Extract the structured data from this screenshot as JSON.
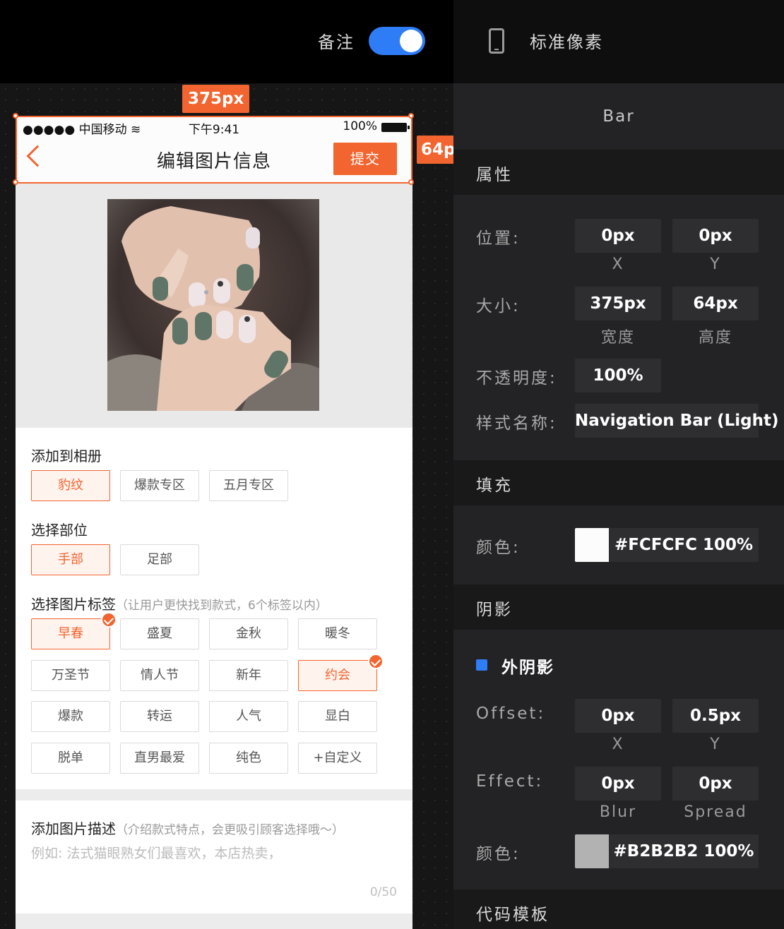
{
  "topbar": {
    "note_label": "备注",
    "note_toggle_on": true,
    "standard_label": "标准像素"
  },
  "overlay": {
    "width_badge": "375px",
    "height_badge": "64p"
  },
  "phone": {
    "status": {
      "carrier": "●●●●● 中国移动 ≋",
      "time": "下午9:41",
      "battery": "100%"
    },
    "nav": {
      "title": "编辑图片信息",
      "submit": "提交"
    },
    "album": {
      "title": "添加到相册",
      "tags": [
        {
          "label": "豹纹",
          "selected": true
        },
        {
          "label": "爆款专区",
          "selected": false
        },
        {
          "label": "五月专区",
          "selected": false
        }
      ]
    },
    "part": {
      "title": "选择部位",
      "tags": [
        {
          "label": "手部",
          "selected": true
        },
        {
          "label": "足部",
          "selected": false
        }
      ]
    },
    "labels": {
      "title": "选择图片标签",
      "hint": "（让用户更快找到款式，6个标签以内）",
      "tags": [
        {
          "label": "早春",
          "selected": true,
          "checked": true
        },
        {
          "label": "盛夏",
          "selected": false
        },
        {
          "label": "金秋",
          "selected": false
        },
        {
          "label": "暖冬",
          "selected": false
        },
        {
          "label": "万圣节",
          "selected": false
        },
        {
          "label": "情人节",
          "selected": false
        },
        {
          "label": "新年",
          "selected": false
        },
        {
          "label": "约会",
          "selected": true,
          "checked": true
        },
        {
          "label": "爆款",
          "selected": false
        },
        {
          "label": "转运",
          "selected": false
        },
        {
          "label": "人气",
          "selected": false
        },
        {
          "label": "显白",
          "selected": false
        },
        {
          "label": "脱单",
          "selected": false
        },
        {
          "label": "直男最爱",
          "selected": false
        },
        {
          "label": "纯色",
          "selected": false
        },
        {
          "label": "+自定义",
          "selected": false
        }
      ]
    },
    "description": {
      "title": "添加图片描述",
      "hint": "（介绍款式特点，会更吸引顾客选择哦～）",
      "placeholder": "例如: 法式猫眼熟女们最喜欢，本店热卖，",
      "count": "0/50"
    }
  },
  "inspector": {
    "title": "Bar",
    "attributes": {
      "header": "属性",
      "position_label": "位置:",
      "pos_x": "0px",
      "pos_x_sub": "X",
      "pos_y": "0px",
      "pos_y_sub": "Y",
      "size_label": "大小:",
      "width": "375px",
      "width_sub": "宽度",
      "height": "64px",
      "height_sub": "高度",
      "opacity_label": "不透明度:",
      "opacity": "100%",
      "style_label": "样式名称:",
      "style_name": "Navigation Bar (Light)"
    },
    "fill": {
      "header": "填充",
      "color_label": "颜色:",
      "color_value": "#FCFCFC 100%",
      "swatch": "#FCFCFC"
    },
    "shadow": {
      "header": "阴影",
      "outer_label": "外阴影",
      "offset_label": "Offset:",
      "offset_x": "0px",
      "offset_x_sub": "X",
      "offset_y": "0.5px",
      "offset_y_sub": "Y",
      "effect_label": "Effect:",
      "blur": "0px",
      "blur_sub": "Blur",
      "spread": "0px",
      "spread_sub": "Spread",
      "color_label": "颜色:",
      "color_value": "#B2B2B2 100%",
      "swatch": "#B2B2B2"
    },
    "code_template": {
      "header": "代码模板"
    }
  },
  "colors": {
    "accent": "#F26530",
    "toggle": "#2F7DF6"
  }
}
